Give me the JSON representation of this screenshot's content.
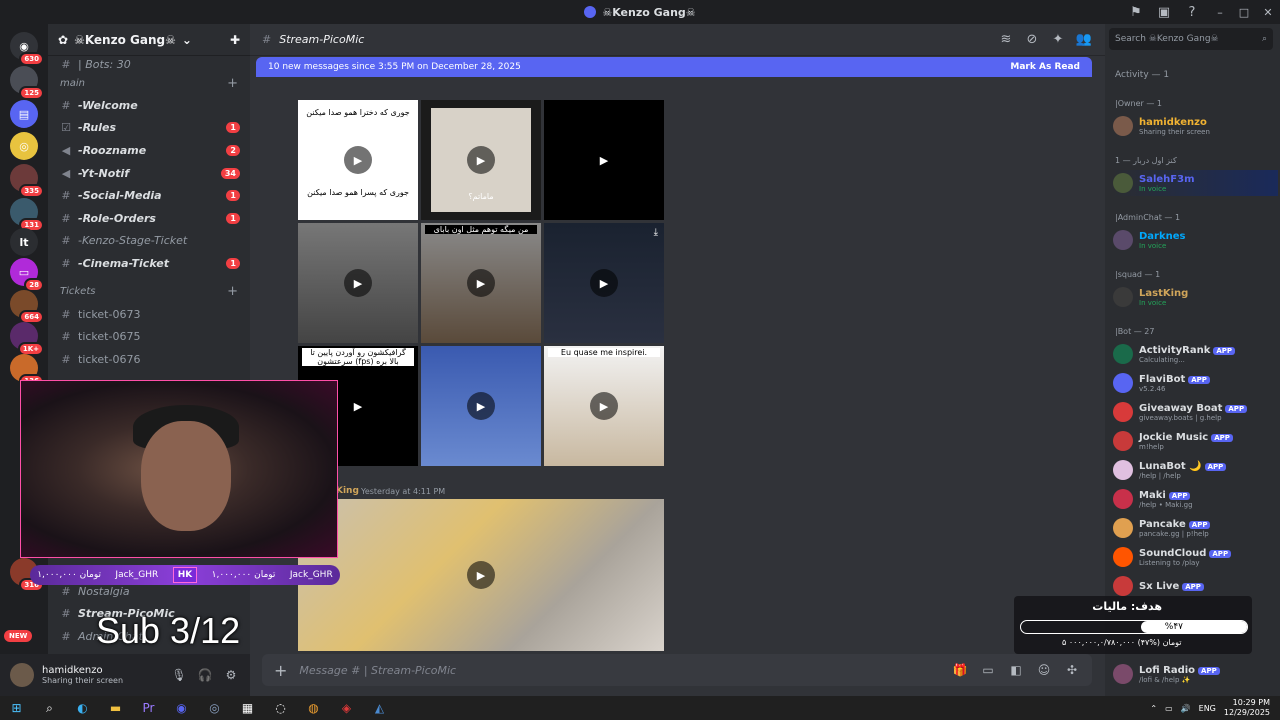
{
  "window": {
    "title": "☠Kenzo Gang☠"
  },
  "sidebar": {
    "guild_name": "☠Kenzo Gang☠",
    "bots_label": "| Bots: 30",
    "category_main": "main",
    "channels": [
      {
        "name": "-Welcome",
        "badge": ""
      },
      {
        "name": "-Rules",
        "badge": "1"
      },
      {
        "name": "-Roozname",
        "badge": "2"
      },
      {
        "name": "-Yt-Notif",
        "badge": "34"
      },
      {
        "name": "-Social-Media",
        "badge": "1"
      },
      {
        "name": "-Role-Orders",
        "badge": "1"
      },
      {
        "name": "-Kenzo-Stage-Ticket",
        "badge": ""
      },
      {
        "name": "-Cinema-Ticket",
        "badge": "1"
      }
    ],
    "category_tickets": "Tickets",
    "tickets": [
      "ticket-0673",
      "ticket-0675",
      "ticket-0676"
    ],
    "lower_channels": [
      "Nostalgia",
      "Stream-PicoMic",
      "Admin-Chat"
    ]
  },
  "server_badges": [
    "630",
    "125",
    "335",
    "131",
    "28",
    "664",
    "1K+",
    "136",
    "316"
  ],
  "user": {
    "name": "hamidkenzo",
    "status": "Sharing their screen"
  },
  "channel": {
    "name": "Stream-PicoMic",
    "new_messages": "10 new messages since 3:55 PM on December 28, 2025",
    "mark_read": "Mark As Read",
    "composer_placeholder": "Message # | Stream-PicoMic"
  },
  "media": {
    "captions": [
      "جوری که دخترا همو صدا میکنن",
      "جوری که پسرا همو صدا میکنن",
      "ماماتم؟",
      "من میگه توهم مثل اون بابای",
      "گرافیکشون رو آوردن پایین تا سرعتشون (fps) بالا بره",
      "Eu quase me inspirei."
    ],
    "message_author": "King",
    "message_time": "Yesterday at 4:11 PM"
  },
  "members": {
    "search_placeholder": "Search ☠Kenzo Gang☠",
    "activity": "Activity — 1",
    "groups": [
      {
        "label": "|Owner — 1"
      },
      {
        "label": "کنز اول دربار — 1"
      },
      {
        "label": "|AdminChat — 1"
      },
      {
        "label": "|squad — 1"
      },
      {
        "label": "|Bot — 27"
      }
    ],
    "list": [
      {
        "name": "hamidkenzo",
        "sub": "Sharing their screen",
        "color": "#f0b232",
        "app": ""
      },
      {
        "name": "SalehF3m",
        "sub": "In voice",
        "color": "#5865f2",
        "app": ""
      },
      {
        "name": "Darknes",
        "sub": "In voice",
        "color": "#00a8fc",
        "app": ""
      },
      {
        "name": "LastKing",
        "sub": "In voice",
        "color": "#d0a55a",
        "app": ""
      },
      {
        "name": "ActivityRank",
        "sub": "Calculating...",
        "color": "#dbdee1",
        "app": "APP"
      },
      {
        "name": "FlaviBot",
        "sub": "v5.2.46",
        "color": "#dbdee1",
        "app": "APP"
      },
      {
        "name": "Giveaway Boat",
        "sub": "giveaway.boats | g.help",
        "color": "#dbdee1",
        "app": "APP"
      },
      {
        "name": "Jockie Music",
        "sub": "m!help",
        "color": "#dbdee1",
        "app": "APP"
      },
      {
        "name": "LunaBot 🌙",
        "sub": "/help | /help",
        "color": "#dbdee1",
        "app": "APP"
      },
      {
        "name": "Maki",
        "sub": "/help • Maki.gg",
        "color": "#dbdee1",
        "app": "APP"
      },
      {
        "name": "Pancake",
        "sub": "pancake.gg | p!help",
        "color": "#dbdee1",
        "app": "APP"
      },
      {
        "name": "SoundCloud",
        "sub": "Listening to /play",
        "color": "#dbdee1",
        "app": "APP"
      },
      {
        "name": "Sx Live",
        "sub": "",
        "color": "#dbdee1",
        "app": "APP"
      },
      {
        "name": "Lofi Radio",
        "sub": "/lofi & /help ✨",
        "color": "#dbdee1",
        "app": "APP"
      }
    ]
  },
  "overlay": {
    "sub_text": "Sub 3/12",
    "ticker_name": "Jack_GHR",
    "ticker_amount": "۱,۰۰۰,۰۰۰ تومان",
    "ticker_logo": "HK",
    "goal_title": "هدف: مالیات",
    "goal_percent": "%۴۷",
    "goal_progress": 0.47,
    "goal_sub": "۵ تومان (%۴۷) ۰۰۰,۰۰۰,۰/۷۸۰,۰۰۰",
    "new_badge": "NEW"
  },
  "taskbar": {
    "lang": "ENG",
    "time": "10:29 PM",
    "date": "12/29/2025"
  },
  "colors": {
    "accent": "#5865f2",
    "badge_red": "#f23f43",
    "online": "#23a55a"
  }
}
